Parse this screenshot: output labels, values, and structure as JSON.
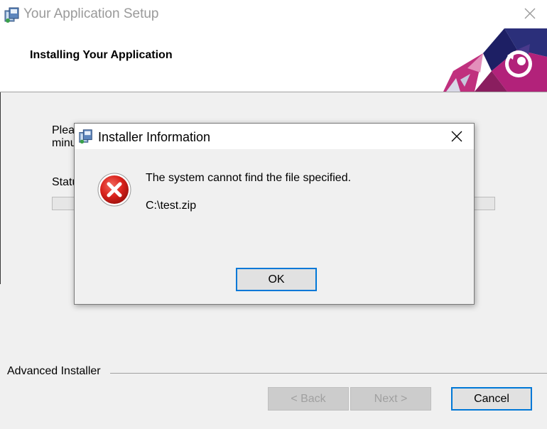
{
  "window": {
    "title": "Your Application Setup",
    "icon": "installer-icon",
    "close_icon": "close-icon"
  },
  "banner": {
    "title": "Installing Your Application"
  },
  "progress_page": {
    "please_wait_line1": "Plea",
    "please_wait_line2": "minu",
    "status_label": "Statu",
    "progress": 0
  },
  "footer": {
    "brand": "Advanced Installer",
    "back_label": "< Back",
    "next_label": "Next >",
    "cancel_label": "Cancel"
  },
  "dialog": {
    "title": "Installer Information",
    "icon": "installer-icon",
    "error_icon": "error-icon",
    "message": "The system cannot find the file specified.",
    "path": "C:\\test.zip",
    "ok_label": "OK"
  },
  "colors": {
    "accent": "#0078d7",
    "error_red": "#d9221c",
    "banner_magenta": "#b2227a",
    "banner_navy": "#1d1f64"
  }
}
